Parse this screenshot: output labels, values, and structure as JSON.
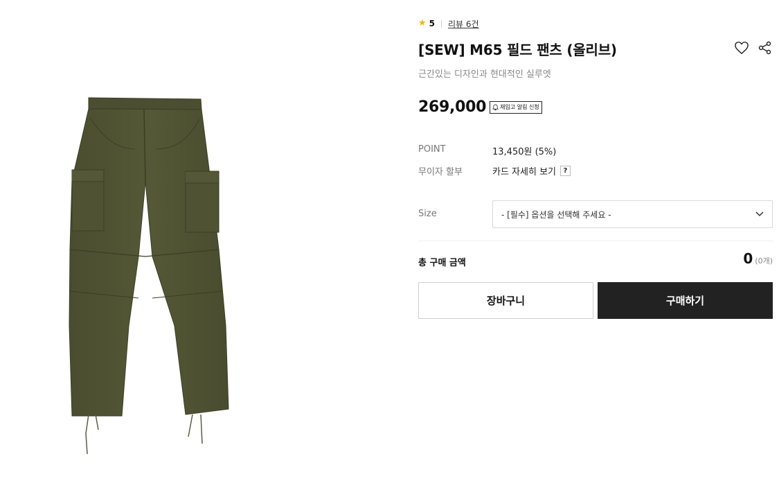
{
  "product": {
    "rating": "5",
    "review_link": "리뷰 6건",
    "title": "[SEW] M65 필드 팬츠 (올리브)",
    "subtitle": "근간있는 디자인과 현대적인 실루엣",
    "price": "269,000",
    "restock_label": "재입고 알림 신청",
    "image_icon": "olive-cargo-pants-image"
  },
  "details": {
    "point_label": "POINT",
    "point_value": "13,450원 (5%)",
    "installment_label": "무이자 할부",
    "installment_value": "카드 자세히 보기",
    "help_badge": "?"
  },
  "options": {
    "size_label": "Size",
    "size_placeholder": "- [필수] 옵션을 선택해 주세요 -"
  },
  "total": {
    "label": "총 구매 금액",
    "amount": "0",
    "count": "(0개)"
  },
  "actions": {
    "cart_label": "장바구니",
    "buy_label": "구매하기"
  },
  "colors": {
    "star": "#f2b705",
    "buy_button": "#222222",
    "pants": "#4f5233"
  },
  "icons": {
    "star": "star-icon",
    "wishlist": "heart-icon",
    "share": "share-icon",
    "bell": "bell-icon",
    "select": "chevron-down-icon"
  }
}
